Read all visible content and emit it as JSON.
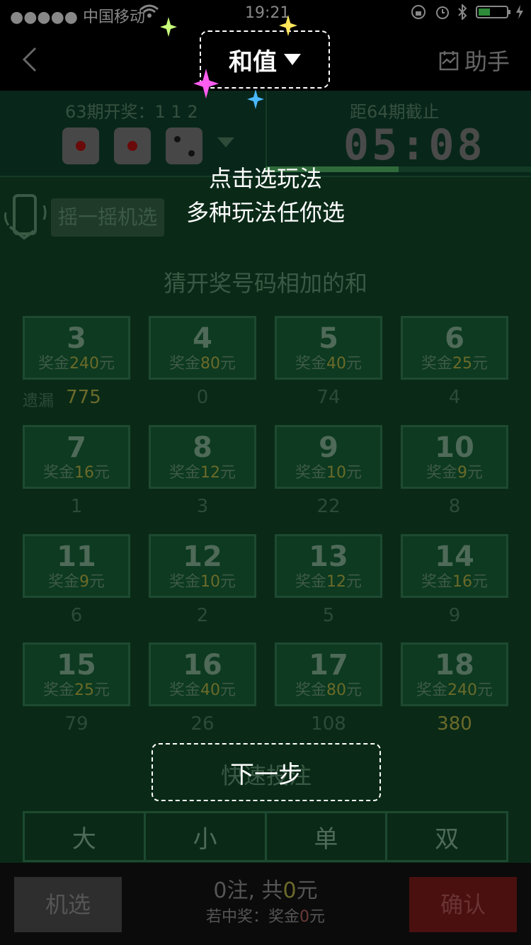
{
  "status_bar": {
    "carrier": "●●●●● 中国移动",
    "time": "19:21"
  },
  "nav": {
    "title": "和值",
    "helper": "助手"
  },
  "draw": {
    "last_draw_label": "63期开奖：1 1 2",
    "dice": [
      1,
      1,
      2
    ],
    "deadline_label": "距64期截止",
    "countdown": "05:08",
    "progress": 0.5
  },
  "guide": {
    "line1": "点击选玩法",
    "line2": "多种玩法任你选",
    "next_button": "下一步"
  },
  "shake": {
    "label": "摇一摇机选"
  },
  "hint": "猜开奖号码相加的和",
  "grid": {
    "miss_label": "遗漏",
    "prize_prefix": "奖金",
    "prize_suffix": "元",
    "cells": [
      {
        "num": "3",
        "prize": "240",
        "miss": "775"
      },
      {
        "num": "4",
        "prize": "80",
        "miss": "0"
      },
      {
        "num": "5",
        "prize": "40",
        "miss": "74"
      },
      {
        "num": "6",
        "prize": "25",
        "miss": "4"
      },
      {
        "num": "7",
        "prize": "16",
        "miss": "1"
      },
      {
        "num": "8",
        "prize": "12",
        "miss": "3"
      },
      {
        "num": "9",
        "prize": "10",
        "miss": "22"
      },
      {
        "num": "10",
        "prize": "9",
        "miss": "8"
      },
      {
        "num": "11",
        "prize": "9",
        "miss": "6"
      },
      {
        "num": "12",
        "prize": "10",
        "miss": "2"
      },
      {
        "num": "13",
        "prize": "12",
        "miss": "5"
      },
      {
        "num": "14",
        "prize": "16",
        "miss": "9"
      },
      {
        "num": "15",
        "prize": "25",
        "miss": "79"
      },
      {
        "num": "16",
        "prize": "40",
        "miss": "26"
      },
      {
        "num": "17",
        "prize": "80",
        "miss": "108"
      },
      {
        "num": "18",
        "prize": "240",
        "miss": "380"
      }
    ]
  },
  "quick": {
    "label": "快速投注",
    "options": [
      "大",
      "小",
      "单",
      "双"
    ]
  },
  "bottom": {
    "random_button": "机选",
    "confirm_button": "确认",
    "summary_prefix": "0注, 共",
    "summary_amount": "0",
    "summary_suffix": "元",
    "prize_prefix": "若中奖：奖金",
    "prize_amount": "0",
    "prize_suffix": "元"
  },
  "colors": {
    "background": "#0a2a17",
    "cell_border": "#1d4a30",
    "prize_amount": "#6b6a2a",
    "confirm": "#4a1010"
  }
}
